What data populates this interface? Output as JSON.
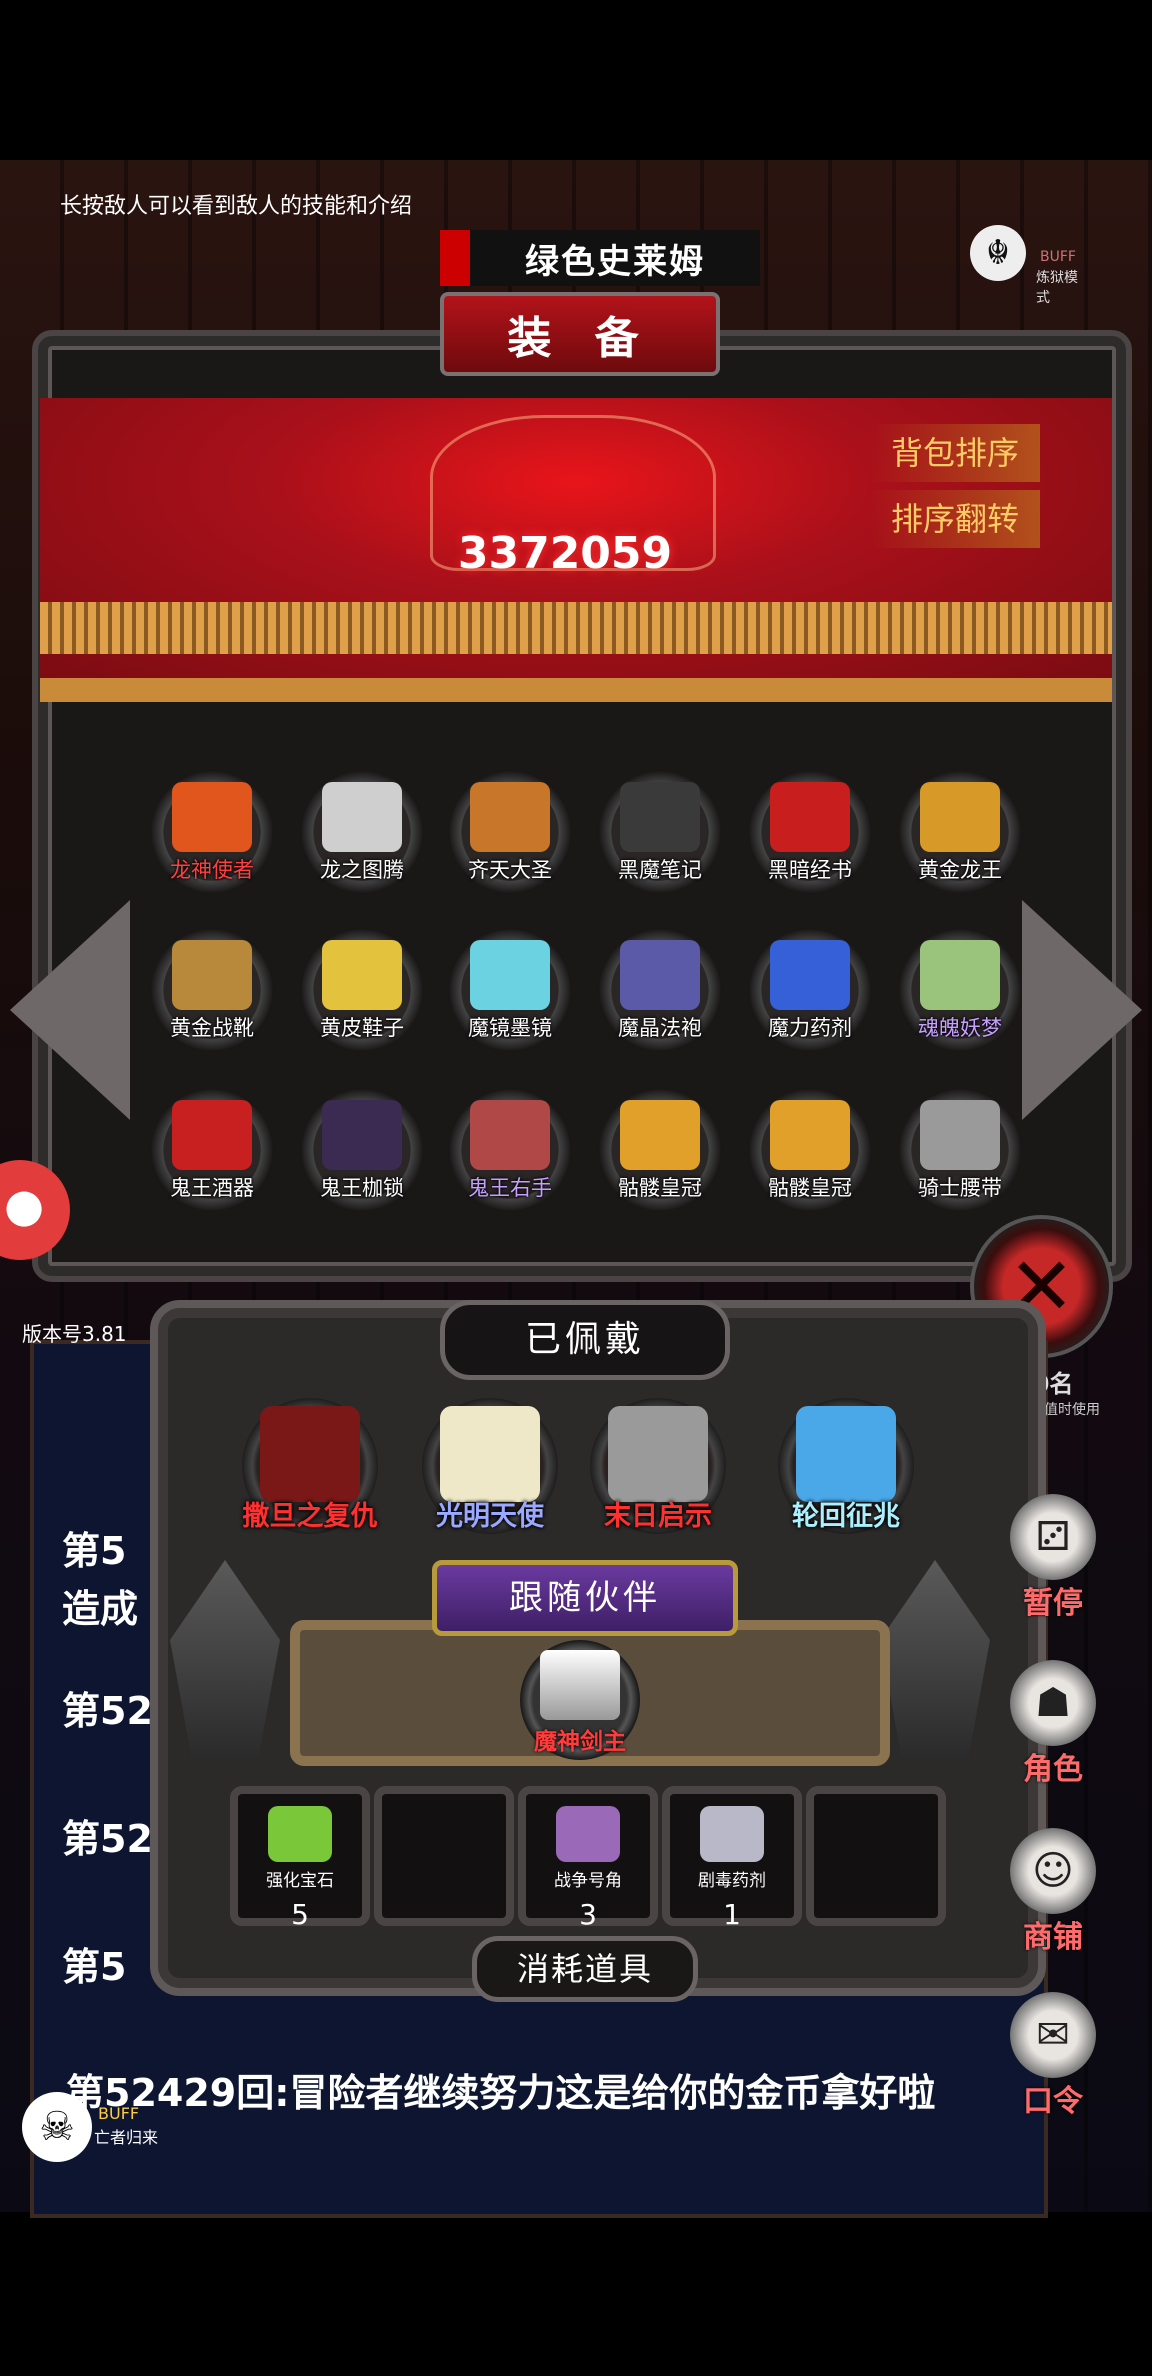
{
  "hint": "长按敌人可以看到敌人的技能和介绍",
  "enemy_name": "绿色史莱姆",
  "mode_badge": {
    "icon": "dragon-icon",
    "line1": "BUFF",
    "line2": "炼狱模式"
  },
  "equipment": {
    "title": "装 备",
    "power": "3372059",
    "sort_button": "背包排序",
    "flip_button": "排序翻转",
    "items": [
      {
        "label": "龙神使者",
        "color": "red",
        "art": "#e0561c"
      },
      {
        "label": "龙之图腾",
        "color": "white",
        "art": "#cfcfcf"
      },
      {
        "label": "齐天大圣",
        "color": "white",
        "art": "#c8762a"
      },
      {
        "label": "黑魔笔记",
        "color": "white",
        "art": "#3a3a3a"
      },
      {
        "label": "黑暗经书",
        "color": "white",
        "art": "#c81e1e"
      },
      {
        "label": "黄金龙王",
        "color": "white",
        "art": "#d79a28"
      },
      {
        "label": "黄金战靴",
        "color": "white",
        "art": "#b8893a"
      },
      {
        "label": "黄皮鞋子",
        "color": "white",
        "art": "#e3c23e"
      },
      {
        "label": "魔镜墨镜",
        "color": "white",
        "art": "#6ad2e0"
      },
      {
        "label": "魔晶法袍",
        "color": "white",
        "art": "#5a5aa8"
      },
      {
        "label": "魔力药剂",
        "color": "white",
        "art": "#3560d8"
      },
      {
        "label": "魂魄妖梦",
        "color": "purple",
        "art": "#9ac47c"
      },
      {
        "label": "鬼王酒器",
        "color": "white",
        "art": "#c82020"
      },
      {
        "label": "鬼王枷锁",
        "color": "white",
        "art": "#3b2a52"
      },
      {
        "label": "鬼王右手",
        "color": "purple",
        "art": "#b04848"
      },
      {
        "label": "骷髅皇冠",
        "color": "white",
        "art": "#e0a02a"
      },
      {
        "label": "骷髅皇冠",
        "color": "white",
        "art": "#e0a02a"
      },
      {
        "label": "骑士腰带",
        "color": "white",
        "art": "#9a9a9a"
      }
    ]
  },
  "version": "版本号3.81",
  "right_info": {
    "big": "50名",
    "small": "其数值时使用"
  },
  "worn": {
    "title": "已佩戴",
    "items": [
      {
        "label": "撒旦之复仇",
        "color": "#ff3030",
        "art": "#7a1818"
      },
      {
        "label": "光明天使",
        "color": "#9aa8ff",
        "art": "#efe8c8"
      },
      {
        "label": "末日启示",
        "color": "#ff3030",
        "art": "#9a9a9a"
      },
      {
        "label": "轮回征兆",
        "color": "#aaf0ff",
        "art": "#4aa8e8"
      }
    ]
  },
  "companion": {
    "title": "跟随伙伴",
    "name": "魔神剑主"
  },
  "consumables": {
    "title": "消耗道具",
    "items": [
      {
        "label": "强化宝石",
        "qty": "5",
        "art": "#7ac83a"
      },
      {
        "label": "",
        "qty": "",
        "art": ""
      },
      {
        "label": "战争号角",
        "qty": "3",
        "art": "#9a6ab8"
      },
      {
        "label": "剧毒药剂",
        "qty": "1",
        "art": "#b8b8c8"
      },
      {
        "label": "",
        "qty": "",
        "art": ""
      }
    ]
  },
  "log": {
    "line1": "第5",
    "line2": "造成",
    "line3": "第52",
    "line4": "第52",
    "line5": "第5",
    "line6": "第52429回:冒险者继续努力这是给你的金币拿好啦"
  },
  "side_menu": [
    {
      "label": "暂停",
      "icon": "dice-icon",
      "glyph": "⚂"
    },
    {
      "label": "角色",
      "icon": "hooded-figure-icon",
      "glyph": "☗"
    },
    {
      "label": "商铺",
      "icon": "merchant-icon",
      "glyph": "☺"
    },
    {
      "label": "口令",
      "icon": "scroll-icon",
      "glyph": "✉"
    }
  ],
  "footer_buff": {
    "line1": "BUFF",
    "line2": "亡者归来",
    "icon": "skull-icon"
  }
}
